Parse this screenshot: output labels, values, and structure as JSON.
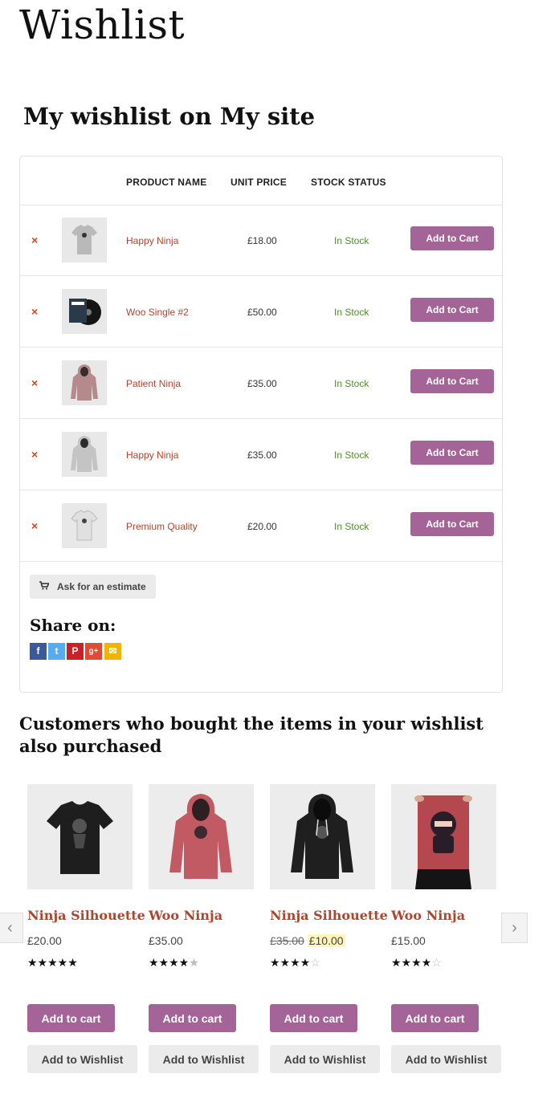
{
  "page": {
    "title": "Wishlist"
  },
  "wishlist": {
    "heading": "My wishlist on My site",
    "columns": {
      "name": "PRODUCT NAME",
      "price": "UNIT PRICE",
      "stock": "STOCK STATUS"
    },
    "rows": [
      {
        "name": "Happy Ninja",
        "price": "£18.00",
        "stock": "In Stock",
        "button": "Add to Cart",
        "thumb": "tshirt-icon"
      },
      {
        "name": "Woo Single #2",
        "price": "£50.00",
        "stock": "In Stock",
        "button": "Add to Cart",
        "thumb": "vinyl-icon"
      },
      {
        "name": "Patient Ninja",
        "price": "£35.00",
        "stock": "In Stock",
        "button": "Add to Cart",
        "thumb": "hoodie-icon"
      },
      {
        "name": "Happy Ninja",
        "price": "£35.00",
        "stock": "In Stock",
        "button": "Add to Cart",
        "thumb": "hoodie-icon"
      },
      {
        "name": "Premium Quality",
        "price": "£20.00",
        "stock": "In Stock",
        "button": "Add to Cart",
        "thumb": "tshirt-icon"
      }
    ],
    "remove_symbol": "×",
    "estimate_label": "Ask for an estimate",
    "share_label": "Share on:",
    "social": [
      {
        "name": "facebook-icon",
        "glyph": "f",
        "color": "#3b5998"
      },
      {
        "name": "twitter-icon",
        "glyph": "t",
        "color": "#55acee"
      },
      {
        "name": "pinterest-icon",
        "glyph": "P",
        "color": "#cb2027"
      },
      {
        "name": "googleplus-icon",
        "glyph": "g+",
        "color": "#dd4b39"
      },
      {
        "name": "email-icon",
        "glyph": "✉",
        "color": "#f0b400"
      }
    ]
  },
  "related": {
    "heading": "Customers who bought the items in your wishlist also purchased",
    "products": [
      {
        "title": "Ninja Silhouette",
        "price": "£20.00",
        "old_price": "",
        "rating": 5,
        "add_label": "Add to cart",
        "wish_label": "Add to Wishlist",
        "image": "black-tshirt-icon"
      },
      {
        "title": "Woo Ninja",
        "price": "£35.00",
        "old_price": "",
        "rating": 4.5,
        "add_label": "Add to cart",
        "wish_label": "Add to Wishlist",
        "image": "red-hoodie-icon"
      },
      {
        "title": "Ninja Silhouette",
        "price": "£10.00",
        "old_price": "£35.00",
        "rating": 4,
        "add_label": "Add to cart",
        "wish_label": "Add to Wishlist",
        "image": "black-hoodie-icon"
      },
      {
        "title": "Woo Ninja",
        "price": "£15.00",
        "old_price": "",
        "rating": 4,
        "add_label": "Add to cart",
        "wish_label": "Add to Wishlist",
        "image": "ninja-poster-icon"
      }
    ],
    "prev_arrow": "‹",
    "next_arrow": "›"
  },
  "colors": {
    "accent": "#a46497",
    "link": "#b0452e",
    "in_stock": "#4e8c2c",
    "remove": "#e2401c"
  }
}
